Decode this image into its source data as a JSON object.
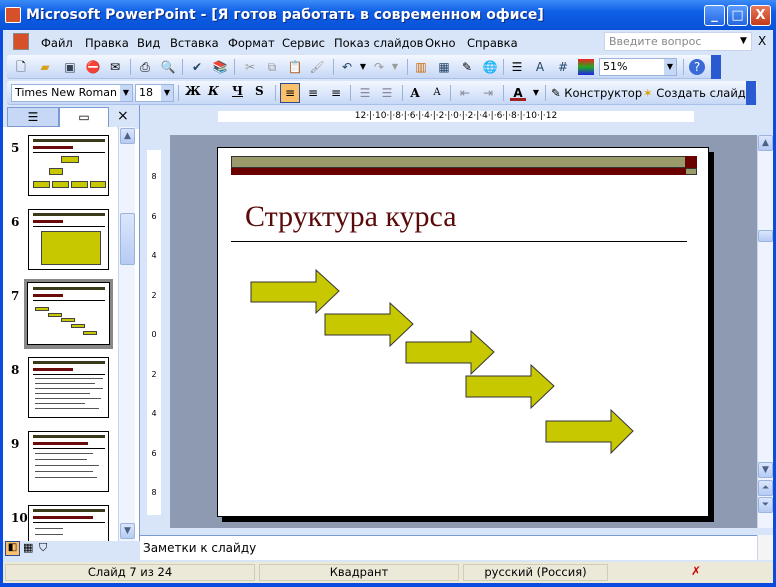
{
  "window": {
    "title": "Microsoft PowerPoint - [Я готов работать в современном офисе]",
    "minimize": "_",
    "maximize": "□",
    "close": "X"
  },
  "menu": {
    "items": [
      "Файл",
      "Правка",
      "Вид",
      "Вставка",
      "Формат",
      "Сервис",
      "Показ слайдов",
      "Окно",
      "Справка"
    ],
    "ask_placeholder": "Введите вопрос",
    "close_doc": "X"
  },
  "toolbar": {
    "zoom": "51%"
  },
  "formatting": {
    "font": "Times New Roman",
    "size": "18",
    "bold": "Ж",
    "italic": "К",
    "underline": "Ч",
    "shadow": "S",
    "designer": "Конструктор",
    "new_slide": "Создать слайд"
  },
  "pane": {
    "close": "×",
    "slides": [
      "5",
      "6",
      "7",
      "8",
      "9",
      "10"
    ],
    "selected": "7"
  },
  "ruler": {
    "h": "12·|·10·|·8·|·6·|·4·|·2·|·0·|·2·|·4·|·6·|·8·|·10·|·12",
    "v": [
      "8",
      "6",
      "4",
      "2",
      "0",
      "2",
      "4",
      "6",
      "8"
    ]
  },
  "slide": {
    "title": "Структура курса",
    "colors": {
      "band": "#9a9a6a",
      "accent": "#6b0000",
      "arrow": "#c8c800",
      "title": "#5a0a0a"
    }
  },
  "notes": {
    "placeholder": "Заметки к слайду"
  },
  "status": {
    "slide": "Слайд 7 из 24",
    "design": "Квадрант",
    "language": "русский (Россия)"
  }
}
